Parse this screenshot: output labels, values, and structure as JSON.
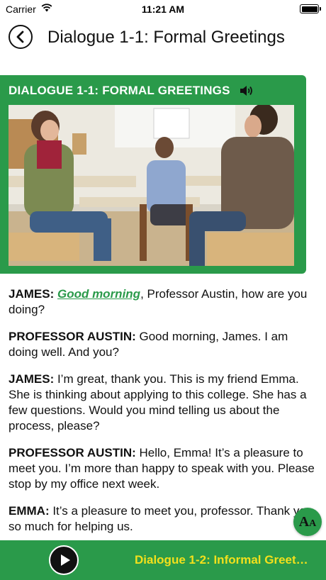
{
  "status_bar": {
    "carrier": "Carrier",
    "time": "11:21 AM"
  },
  "nav": {
    "title": "Dialogue 1-1: Formal Greetings"
  },
  "card": {
    "header": "DIALOGUE 1-1: FORMAL GREETINGS",
    "accent_color": "#2a9a4a"
  },
  "dialogue": [
    {
      "speaker": "JAMES:",
      "highlight": "Good morning",
      "text": ", Professor Austin, how are you doing?"
    },
    {
      "speaker": "PROFESSOR AUSTIN:",
      "text": " Good morning, James. I am doing well. And you?"
    },
    {
      "speaker": "JAMES:",
      "text": " I’m great, thank you. This is my friend Emma. She is thinking about applying to this college. She has a few questions. Would you mind telling us about the process, please?"
    },
    {
      "speaker": "PROFESSOR AUSTIN:",
      "text": " Hello, Emma! It’s a pleasure to meet you. I’m more than happy to speak with you. Please stop by my office next week."
    },
    {
      "speaker": "EMMA:",
      "text": " It’s a pleasure to meet you, professor. Thank you so much for helping us."
    }
  ],
  "font_size_button": {
    "big": "A",
    "small": "A"
  },
  "bottom_bar": {
    "next_label": "Dialogue 1-2: Informal Greet…",
    "next_color": "#f2e01c"
  }
}
